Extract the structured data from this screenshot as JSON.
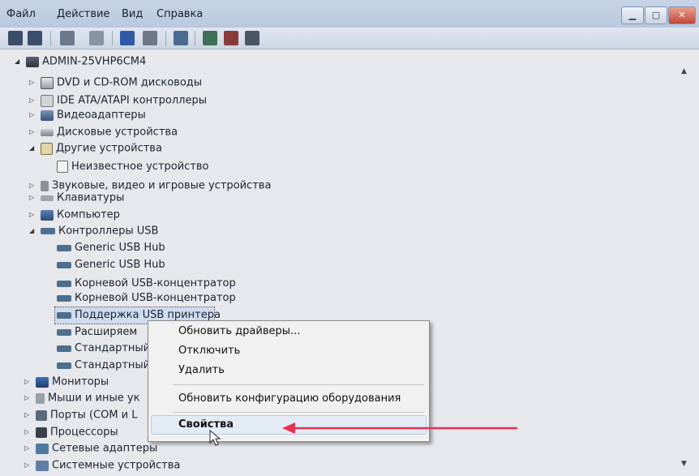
{
  "menubar": {
    "items": [
      "Файл",
      "Действие",
      "Вид",
      "Справка"
    ]
  },
  "window_controls": [
    "minimize",
    "maximize",
    "close"
  ],
  "tree": {
    "root": "ADMIN-25VHP6CM4",
    "nodes": [
      {
        "label": "DVD и CD-ROM дисководы",
        "icon": "dvd-icon"
      },
      {
        "label": "IDE ATA/ATAPI контроллеры",
        "icon": "ide-icon"
      },
      {
        "label": "Видеоадаптеры",
        "icon": "video-adapter-icon"
      },
      {
        "label": "Дисковые устройства",
        "icon": "disk-icon"
      },
      {
        "label": "Другие устройства",
        "icon": "other-devices-icon"
      },
      {
        "label": "Неизвестное устройство",
        "icon": "unknown-device-icon"
      },
      {
        "label": "Звуковые, видео и игровые устройства",
        "icon": "sound-icon"
      },
      {
        "label": "Клавиатуры",
        "icon": "keyboard-icon"
      },
      {
        "label": "Компьютер",
        "icon": "computer-icon"
      },
      {
        "label": "Контроллеры USB",
        "icon": "usb-icon"
      },
      {
        "label": "Generic USB Hub",
        "icon": "usb-icon"
      },
      {
        "label": "Generic USB Hub",
        "icon": "usb-icon"
      },
      {
        "label": "Корневой USB-концентратор",
        "icon": "usb-icon"
      },
      {
        "label": "Корневой USB-концентратор",
        "icon": "usb-icon"
      },
      {
        "label": "Поддержка USB принтера",
        "icon": "usb-icon"
      },
      {
        "label": "Расширяем",
        "icon": "usb-icon"
      },
      {
        "label": "Стандартный",
        "icon": "usb-icon"
      },
      {
        "label": "Стандартный",
        "icon": "usb-icon"
      },
      {
        "label": "Мониторы",
        "icon": "monitor-icon"
      },
      {
        "label": "Мыши и иные ук",
        "icon": "mouse-icon"
      },
      {
        "label": "Порты (COM и L",
        "icon": "port-icon"
      },
      {
        "label": "Процессоры",
        "icon": "processor-icon"
      },
      {
        "label": "Сетевые адаптеры",
        "icon": "network-adapter-icon"
      },
      {
        "label": "Системные устройства",
        "icon": "system-device-icon"
      }
    ]
  },
  "context_menu": {
    "items": [
      "Обновить драйверы...",
      "Отключить",
      "Удалить",
      "Обновить конфигурацию оборудования",
      "Свойства"
    ],
    "highlighted": "Свойства"
  },
  "colors": {
    "annotation_arrow": "#e8324f",
    "selection": "#cfdcef"
  }
}
